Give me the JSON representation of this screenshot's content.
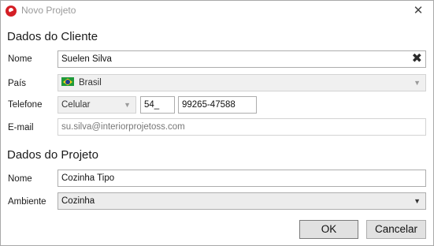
{
  "window": {
    "title": "Novo Projeto"
  },
  "cliente": {
    "section_title": "Dados do Cliente",
    "nome_label": "Nome",
    "nome_value": "Suelen Silva",
    "pais_label": "País",
    "pais_value": "Brasil",
    "telefone_label": "Telefone",
    "telefone_tipo": "Celular",
    "telefone_ddd": "54_",
    "telefone_numero": "99265-47588",
    "email_label": "E-mail",
    "email_value": "su.silva@interiorprojetoss.com"
  },
  "projeto": {
    "section_title": "Dados do Projeto",
    "nome_label": "Nome",
    "nome_value": "Cozinha Tipo",
    "ambiente_label": "Ambiente",
    "ambiente_value": "Cozinha"
  },
  "buttons": {
    "ok": "OK",
    "cancel": "Cancelar"
  },
  "icons": {
    "app": "app-logo-icon",
    "close": "close-icon",
    "clear": "clear-x-icon",
    "flag": "brazil-flag-icon",
    "dropdown": "chevron-down-icon"
  }
}
